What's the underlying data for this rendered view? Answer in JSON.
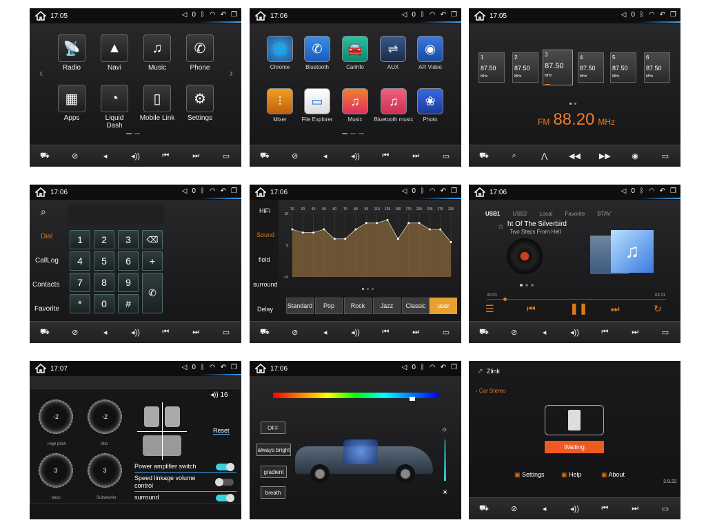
{
  "status": {
    "times": [
      "17:05",
      "17:06",
      "17:05",
      "17:06",
      "17:06",
      "17:06",
      "17:07",
      "17:06"
    ],
    "icons": [
      "volume-mute-icon",
      "bluetooth-icon",
      "wifi-icon",
      "back-icon",
      "window-icon"
    ],
    "vol_count": "0"
  },
  "bottom_bar_icons": [
    "car-home-icon",
    "no-navigation-icon",
    "volume-down-icon",
    "volume-up-icon",
    "previous-icon",
    "next-icon",
    "power-screen-icon"
  ],
  "home1": {
    "apps": [
      "Radio",
      "Navi",
      "Music",
      "Phone",
      "Apps",
      "Liquid Dash",
      "Mobile Link",
      "Settings"
    ]
  },
  "home2": {
    "apps": [
      "Chrome",
      "Bluetooth",
      "Carlnfo",
      "AUX",
      "AR Video",
      "Mixer",
      "File Explorer",
      "Music",
      "Bluetooth music",
      "Photo"
    ]
  },
  "radio": {
    "presets": [
      {
        "num": "1",
        "freq": "87.50",
        "unit": "MHz"
      },
      {
        "num": "2",
        "freq": "87.50",
        "unit": "MHz"
      },
      {
        "num": "3",
        "freq": "87.50",
        "unit": "MHz"
      },
      {
        "num": "4",
        "freq": "87.50",
        "unit": "MHz"
      },
      {
        "num": "5",
        "freq": "87.50",
        "unit": "MHz"
      },
      {
        "num": "6",
        "freq": "87.50",
        "unit": "MHz"
      }
    ],
    "band": "FM",
    "freq": "88.20",
    "unit": "MHz"
  },
  "dialer": {
    "side": [
      "Dial",
      "CallLog",
      "Contacts",
      "Favorite"
    ],
    "keys": [
      "1",
      "2",
      "3",
      "4",
      "5",
      "6",
      "7",
      "8",
      "9",
      "*",
      "0",
      "#"
    ],
    "active": "Dial"
  },
  "eq": {
    "side": [
      "HiFi",
      "Sound",
      "field",
      "surround",
      "Delay"
    ],
    "active": "Sound",
    "bands": [
      "20",
      "30",
      "40",
      "50",
      "60",
      "70",
      "80",
      "95",
      "110",
      "125",
      "150",
      "175",
      "200",
      "235",
      "275",
      "315"
    ],
    "y_ticks": [
      "10",
      "0",
      "-10"
    ],
    "presets": [
      "Standard",
      "Pop",
      "Rock",
      "Jazz",
      "Classic",
      "user"
    ],
    "active_preset": "user"
  },
  "music": {
    "tabs": [
      "USB1",
      "USB2",
      "Local",
      "Favorite",
      "BTAV"
    ],
    "active_tab": "USB1",
    "title": "ht Of The Silverbird",
    "album": "Two Steps From Hell",
    "elapsed": "00:01",
    "total": "03:21"
  },
  "amp": {
    "volume": "16",
    "reset": "Reset",
    "knobs": [
      {
        "name": "High pitch",
        "value": "-2"
      },
      {
        "name": "Alto",
        "value": "-2"
      },
      {
        "name": "bass",
        "value": "3"
      },
      {
        "name": "Subwoofer",
        "value": "3"
      }
    ],
    "switches": [
      {
        "label": "Power amplifier switch",
        "on": true
      },
      {
        "label": "Speed linkage volume control",
        "on": false
      },
      {
        "label": "surround",
        "on": true
      }
    ]
  },
  "ambient": {
    "modes": [
      "OFF",
      "always bright",
      "gradient",
      "breath"
    ]
  },
  "zlink": {
    "brand": "Zlink",
    "back": "Car Stereo",
    "status": "Waiting",
    "actions": [
      "Settings",
      "Help",
      "About"
    ],
    "version": "3.9.22"
  },
  "colors": {
    "accent": "#e0781a",
    "blue": "#3da8ff",
    "toggle": "#3ad0e0"
  }
}
